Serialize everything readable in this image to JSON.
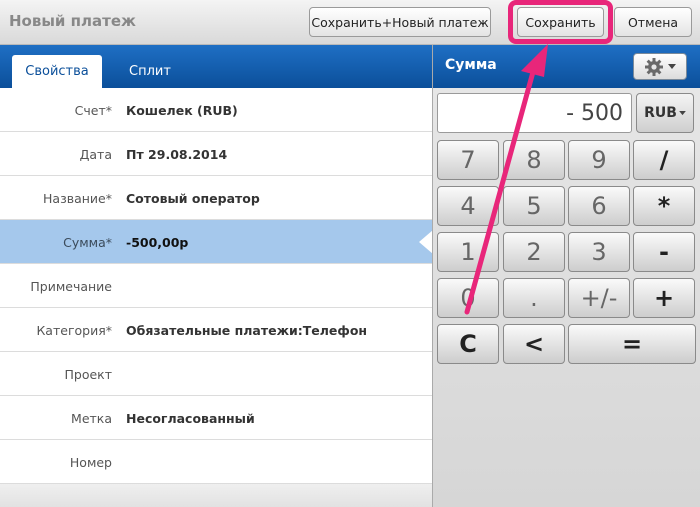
{
  "topbar": {
    "title": "Новый платеж",
    "save_new_label": "Сохранить+Новый платеж",
    "save_label": "Сохранить",
    "cancel_label": "Отмена"
  },
  "tabs": {
    "properties": "Свойства",
    "split": "Сплит"
  },
  "form": {
    "rows": [
      {
        "label": "Счет*",
        "value": "Кошелек (RUB)"
      },
      {
        "label": "Дата",
        "value": "Пт 29.08.2014"
      },
      {
        "label": "Название*",
        "value": "Сотовый оператор"
      },
      {
        "label": "Сумма*",
        "value": "-500,00р"
      },
      {
        "label": "Примечание",
        "value": ""
      },
      {
        "label": "Категория*",
        "value": "Обязательные платежи:Телефон"
      },
      {
        "label": "Проект",
        "value": ""
      },
      {
        "label": "Метка",
        "value": "Несогласованный"
      },
      {
        "label": "Номер",
        "value": ""
      }
    ]
  },
  "calculator": {
    "title": "Сумма",
    "display": "- 500",
    "currency": "RUB",
    "keys": {
      "seven": "7",
      "eight": "8",
      "nine": "9",
      "divide": "/",
      "four": "4",
      "five": "5",
      "six": "6",
      "multiply": "*",
      "one": "1",
      "two": "2",
      "three": "3",
      "minus": "-",
      "zero": "0",
      "dot": ".",
      "sign": "+/-",
      "plus": "+",
      "clear": "C",
      "back": "<",
      "equals": "="
    },
    "gear_icon": "gear-icon"
  },
  "colors": {
    "highlight": "#e8267a",
    "header_blue": "#0b4f9a",
    "selected_row": "#a5c8ec"
  }
}
